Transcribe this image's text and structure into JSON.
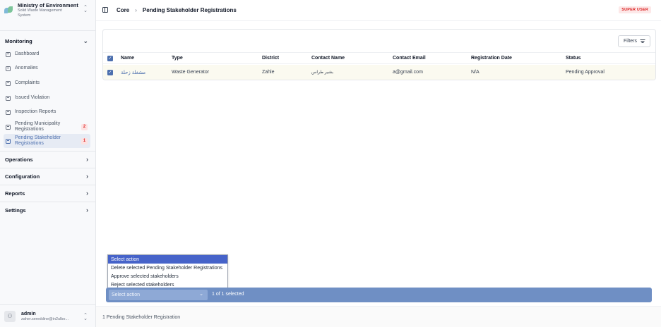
{
  "brand": {
    "title": "Ministry of Environment",
    "subtitle_line1": "Solid Waste Management",
    "subtitle_line2": "System"
  },
  "sidebar": {
    "monitoring_label": "Monitoring",
    "items": [
      {
        "label": "Dashboard"
      },
      {
        "label": "Anomalies"
      },
      {
        "label": "Complaints"
      },
      {
        "label": "Issued Violation"
      },
      {
        "label": "Inspection Reports"
      },
      {
        "label_line1": "Pending Municipality",
        "label_line2": "Registrations",
        "badge": "2"
      },
      {
        "label_line1": "Pending Stakeholder",
        "label_line2": "Registrations",
        "badge": "1",
        "active": true
      }
    ],
    "sections": [
      {
        "label": "Operations"
      },
      {
        "label": "Configuration"
      },
      {
        "label": "Reports"
      },
      {
        "label": "Settings"
      }
    ]
  },
  "user": {
    "name": "admin",
    "email": "zaher.sereddine@in2ulbo..."
  },
  "header": {
    "crumb_root": "Core",
    "crumb_page": "Pending Stakeholder Registrations",
    "role_badge": "SUPER USER"
  },
  "toolbar": {
    "filters_label": "Filters"
  },
  "table": {
    "columns": [
      "Name",
      "Type",
      "District",
      "Contact Name",
      "Contact Email",
      "Registration Date",
      "Status"
    ],
    "rows": [
      [
        "مشغلة زحلة",
        "Waste Generator",
        "Zahle",
        "بشير طراس",
        "a@gmail.com",
        "N/A",
        "Pending Approval"
      ]
    ]
  },
  "actions": {
    "selected_option": "Select action",
    "options": [
      "Select action",
      "Delete selected Pending Stakeholder Registrations",
      "Approve selected stakeholders",
      "Reject selected stakeholders"
    ],
    "select_value": "Select action",
    "selection_count": "1 of 1 selected"
  },
  "footer": {
    "summary": "1 Pending Stakeholder Registration"
  },
  "colors": {
    "accent": "#4c6fae",
    "action_bar": "#6f8fc4",
    "badge_red": "#dc2626"
  }
}
